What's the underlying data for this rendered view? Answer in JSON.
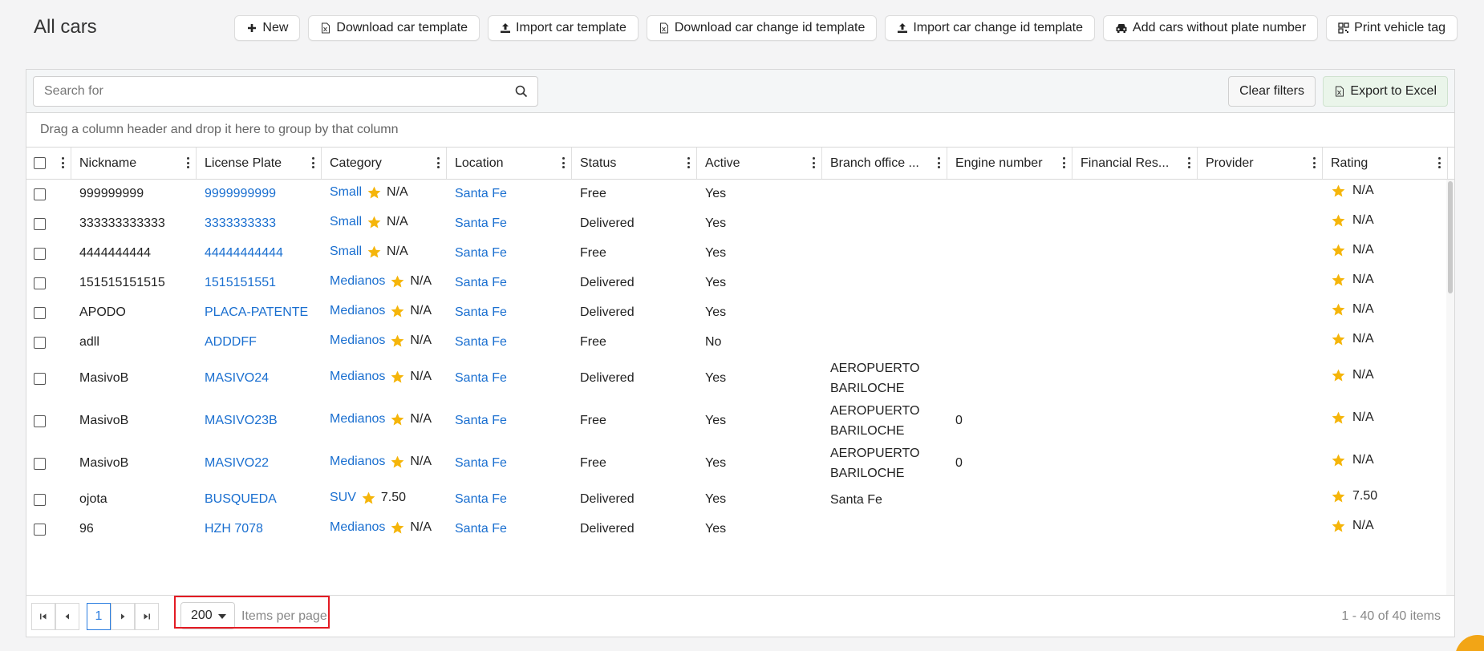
{
  "page": {
    "title": "All cars"
  },
  "toolbar": {
    "buttons": [
      {
        "label": "New",
        "icon": "plus-icon"
      },
      {
        "label": "Download car template",
        "icon": "excel-file-icon"
      },
      {
        "label": "Import car template",
        "icon": "upload-icon"
      },
      {
        "label": "Download car change id template",
        "icon": "excel-file-icon"
      },
      {
        "label": "Import car change id template",
        "icon": "upload-icon"
      },
      {
        "label": "Add cars without plate number",
        "icon": "car-icon"
      },
      {
        "label": "Print vehicle tag",
        "icon": "qr-code-icon"
      }
    ]
  },
  "grid": {
    "search_placeholder": "Search for",
    "clear_filters": "Clear filters",
    "export_excel": "Export to Excel",
    "group_hint": "Drag a column header and drop it here to group by that column",
    "columns": [
      "Nickname",
      "License Plate",
      "Category",
      "Location",
      "Status",
      "Active",
      "Branch office ...",
      "Engine number",
      "Financial Res...",
      "Provider",
      "Rating"
    ],
    "rows": [
      {
        "nickname": "999999999",
        "plate": "9999999999",
        "category": "Small",
        "cat_rating": "N/A",
        "location": "Santa Fe",
        "status": "Free",
        "active": "Yes",
        "branch": "",
        "engine": "",
        "financial": "",
        "provider": "",
        "rating": "N/A"
      },
      {
        "nickname": "333333333333",
        "plate": "3333333333",
        "category": "Small",
        "cat_rating": "N/A",
        "location": "Santa Fe",
        "status": "Delivered",
        "active": "Yes",
        "branch": "",
        "engine": "",
        "financial": "",
        "provider": "",
        "rating": "N/A"
      },
      {
        "nickname": "4444444444",
        "plate": "44444444444",
        "category": "Small",
        "cat_rating": "N/A",
        "location": "Santa Fe",
        "status": "Free",
        "active": "Yes",
        "branch": "",
        "engine": "",
        "financial": "",
        "provider": "",
        "rating": "N/A"
      },
      {
        "nickname": "151515151515",
        "plate": "1515151551",
        "category": "Medianos",
        "cat_rating": "N/A",
        "location": "Santa Fe",
        "status": "Delivered",
        "active": "Yes",
        "branch": "",
        "engine": "",
        "financial": "",
        "provider": "",
        "rating": "N/A"
      },
      {
        "nickname": "APODO",
        "plate": "PLACA-PATENTE",
        "category": "Medianos",
        "cat_rating": "N/A",
        "location": "Santa Fe",
        "status": "Delivered",
        "active": "Yes",
        "branch": "",
        "engine": "",
        "financial": "",
        "provider": "",
        "rating": "N/A"
      },
      {
        "nickname": "adll",
        "plate": "ADDDFF",
        "category": "Medianos",
        "cat_rating": "N/A",
        "location": "Santa Fe",
        "status": "Free",
        "active": "No",
        "branch": "",
        "engine": "",
        "financial": "",
        "provider": "",
        "rating": "N/A"
      },
      {
        "nickname": "MasivoB",
        "plate": "MASIVO24",
        "category": "Medianos",
        "cat_rating": "N/A",
        "location": "Santa Fe",
        "status": "Delivered",
        "active": "Yes",
        "branch": "AEROPUERTO BARILOCHE",
        "engine": "",
        "financial": "",
        "provider": "",
        "rating": "N/A"
      },
      {
        "nickname": "MasivoB",
        "plate": "MASIVO23B",
        "category": "Medianos",
        "cat_rating": "N/A",
        "location": "Santa Fe",
        "status": "Free",
        "active": "Yes",
        "branch": "AEROPUERTO BARILOCHE",
        "engine": "0",
        "financial": "",
        "provider": "",
        "rating": "N/A"
      },
      {
        "nickname": "MasivoB",
        "plate": "MASIVO22",
        "category": "Medianos",
        "cat_rating": "N/A",
        "location": "Santa Fe",
        "status": "Free",
        "active": "Yes",
        "branch": "AEROPUERTO BARILOCHE",
        "engine": "0",
        "financial": "",
        "provider": "",
        "rating": "N/A"
      },
      {
        "nickname": "ojota",
        "plate": "BUSQUEDA",
        "category": "SUV",
        "cat_rating": "7.50",
        "location": "Santa Fe",
        "status": "Delivered",
        "active": "Yes",
        "branch": "Santa Fe",
        "engine": "",
        "financial": "",
        "provider": "",
        "rating": "7.50"
      },
      {
        "nickname": "96",
        "plate": "HZH 7078",
        "category": "Medianos",
        "cat_rating": "N/A",
        "location": "Santa Fe",
        "status": "Delivered",
        "active": "Yes",
        "branch": "",
        "engine": "",
        "financial": "",
        "provider": "",
        "rating": "N/A"
      }
    ]
  },
  "pager": {
    "current_page": "1",
    "page_size": "200",
    "items_per_page": "Items per page:",
    "info": "1 - 40 of 40 items"
  },
  "colors": {
    "link": "#1a6fd0",
    "star": "#f5b50a",
    "highlight": "#e31b23",
    "fab": "#f2a516"
  }
}
